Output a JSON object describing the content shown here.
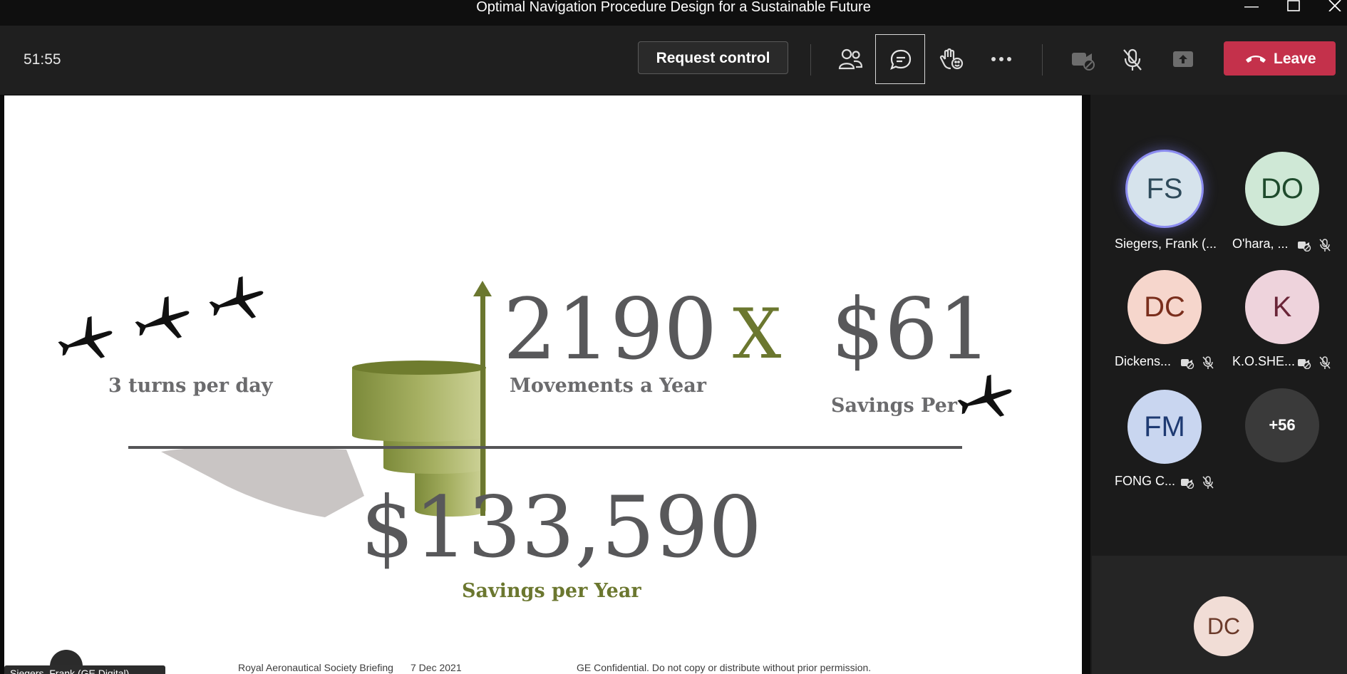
{
  "window": {
    "title": "Optimal Navigation Procedure Design for a Sustainable Future"
  },
  "toolbar": {
    "timer": "51:55",
    "request_control": "Request control",
    "leave": "Leave"
  },
  "slide": {
    "turns_label": "3 turns per day",
    "movements_value": "2190",
    "movements_label": "Movements a Year",
    "multiply": "X",
    "savings_value": "$61",
    "savings_label": "Savings Per",
    "total_value": "$133,590",
    "total_label": "Savings per Year",
    "footer_left": "Royal Aeronautical Society Briefing",
    "footer_date": "7 Dec 2021",
    "footer_right": "GE Confidential. Do not copy or distribute without prior permission.",
    "presenter": "Siegers, Frank (GE Digital)"
  },
  "participants": [
    {
      "initials": "FS",
      "name": "Siegers, Frank (...",
      "bg": "#d6e3ec",
      "fg": "#2e4a5a",
      "speaking": true
    },
    {
      "initials": "DO",
      "name": "O'hara, ...",
      "bg": "#cfe8d6",
      "fg": "#1e4a2c",
      "speaking": false
    },
    {
      "initials": "DC",
      "name": "Dickens...",
      "bg": "#f6d6cc",
      "fg": "#7a2e1c",
      "speaking": false
    },
    {
      "initials": "K",
      "name": "K.O.SHE...",
      "bg": "#eed3dc",
      "fg": "#6a2538",
      "speaking": false
    },
    {
      "initials": "FM",
      "name": "FONG C...",
      "bg": "#c9d6f0",
      "fg": "#1e3a72",
      "speaking": false
    }
  ],
  "more_participants": "+56",
  "self_view": {
    "initials": "DC"
  },
  "colors": {
    "accent_olive": "#6b772f",
    "leave_red": "#c4314b",
    "speaking_ring": "#8b8cf0"
  }
}
